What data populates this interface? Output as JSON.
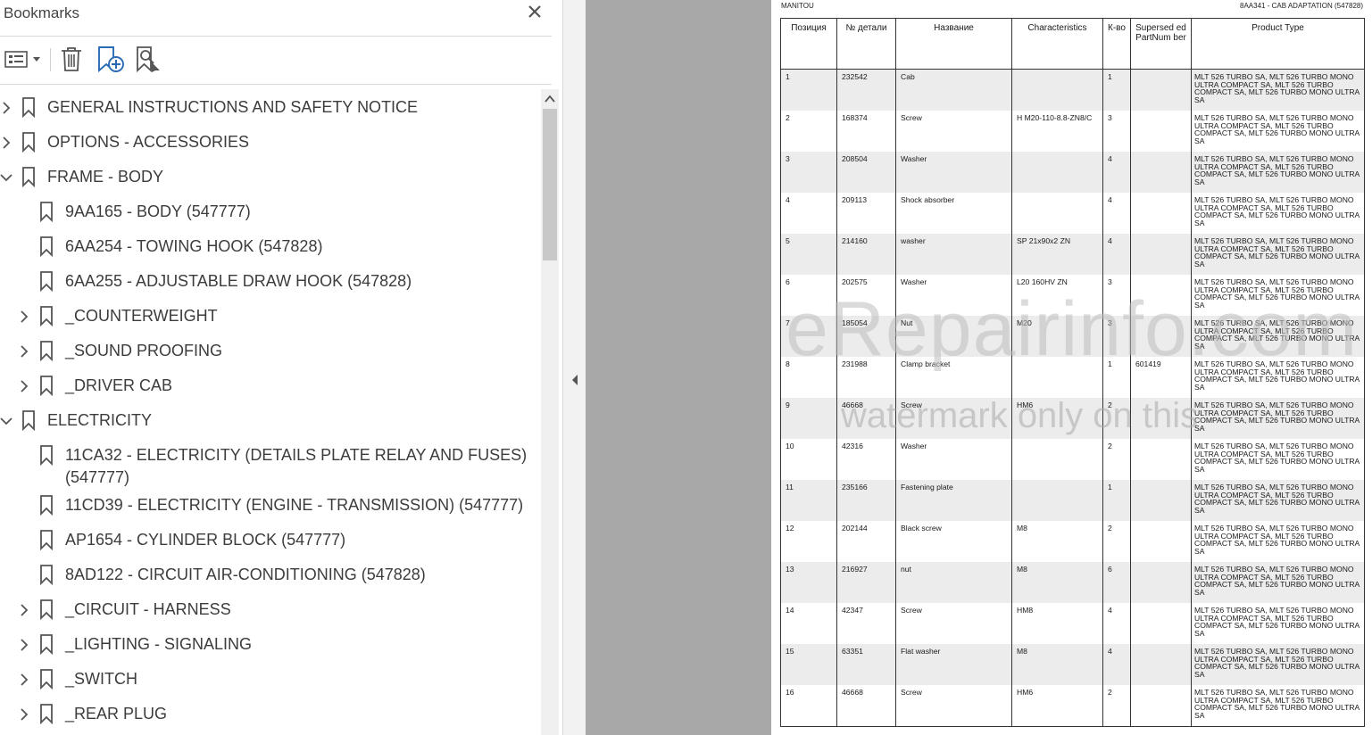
{
  "panel": {
    "title": "Bookmarks",
    "items": [
      {
        "label": "GENERAL INSTRUCTIONS AND SAFETY NOTICE",
        "expander": "collapsed",
        "indent": 0
      },
      {
        "label": "OPTIONS - ACCESSORIES",
        "expander": "collapsed",
        "indent": 0
      },
      {
        "label": "FRAME - BODY",
        "expander": "expanded",
        "indent": 0
      },
      {
        "label": "9AA165 - BODY (547777)",
        "expander": "none",
        "indent": 1
      },
      {
        "label": "6AA254 - TOWING HOOK (547828)",
        "expander": "none",
        "indent": 1
      },
      {
        "label": "6AA255 - ADJUSTABLE DRAW HOOK (547828)",
        "expander": "none",
        "indent": 1
      },
      {
        "label": "_COUNTERWEIGHT",
        "expander": "collapsed",
        "indent": 1
      },
      {
        "label": "_SOUND PROOFING",
        "expander": "collapsed",
        "indent": 1
      },
      {
        "label": "_DRIVER CAB",
        "expander": "collapsed",
        "indent": 1
      },
      {
        "label": "ELECTRICITY",
        "expander": "expanded",
        "indent": 0
      },
      {
        "label": "11CA32 - ELECTRICITY (DETAILS PLATE RELAY AND FUSES)",
        "label2": "(547777)",
        "expander": "none",
        "indent": 1
      },
      {
        "label": "11CD39 - ELECTRICITY (ENGINE - TRANSMISSION) (547777)",
        "expander": "none",
        "indent": 1
      },
      {
        "label": "AP1654 - CYLINDER BLOCK (547777)",
        "expander": "none",
        "indent": 1
      },
      {
        "label": "8AD122 - CIRCUIT AIR-CONDITIONING (547828)",
        "expander": "none",
        "indent": 1
      },
      {
        "label": "_CIRCUIT - HARNESS",
        "expander": "collapsed",
        "indent": 1
      },
      {
        "label": "_LIGHTING  - SIGNALING",
        "expander": "collapsed",
        "indent": 1
      },
      {
        "label": "_SWITCH",
        "expander": "collapsed",
        "indent": 1
      },
      {
        "label": "_REAR PLUG",
        "expander": "collapsed",
        "indent": 1
      }
    ]
  },
  "document": {
    "header_left": "MANITOU",
    "header_right": "8AA341 - CAB ADAPTATION (547828)",
    "columns": [
      "Позиция",
      "№ детали",
      "Название",
      "Characteristics",
      "К-во",
      "Supersed ed PartNum ber",
      "Product Type"
    ],
    "product_type": "MLT 526 TURBO SA, MLT 526 TURBO MONO ULTRA COMPACT SA, MLT 526 TURBO COMPACT SA, MLT 526 TURBO MONO ULTRA SA",
    "rows": [
      {
        "pos": "1",
        "part": "232542",
        "name": "Cab",
        "char": "",
        "qty": "1",
        "sup": ""
      },
      {
        "pos": "2",
        "part": "168374",
        "name": "Screw",
        "char": "H M20-110-8.8-ZN8/C",
        "qty": "3",
        "sup": ""
      },
      {
        "pos": "3",
        "part": "208504",
        "name": "Washer",
        "char": "",
        "qty": "4",
        "sup": ""
      },
      {
        "pos": "4",
        "part": "209113",
        "name": "Shock absorber",
        "char": "",
        "qty": "4",
        "sup": ""
      },
      {
        "pos": "5",
        "part": "214160",
        "name": "washer",
        "char": "SP 21x90x2 ZN",
        "qty": "4",
        "sup": ""
      },
      {
        "pos": "6",
        "part": "202575",
        "name": "Washer",
        "char": "L20 160HV ZN",
        "qty": "3",
        "sup": ""
      },
      {
        "pos": "7",
        "part": "185054",
        "name": "Nut",
        "char": "M20",
        "qty": "3",
        "sup": ""
      },
      {
        "pos": "8",
        "part": "231988",
        "name": "Clamp bracket",
        "char": "",
        "qty": "1",
        "sup": "601419"
      },
      {
        "pos": "9",
        "part": "46668",
        "name": "Screw",
        "char": "HM6",
        "qty": "2",
        "sup": ""
      },
      {
        "pos": "10",
        "part": "42316",
        "name": "Washer",
        "char": "",
        "qty": "2",
        "sup": ""
      },
      {
        "pos": "11",
        "part": "235166",
        "name": "Fastening plate",
        "char": "",
        "qty": "1",
        "sup": ""
      },
      {
        "pos": "12",
        "part": "202144",
        "name": "Black screw",
        "char": "M8",
        "qty": "2",
        "sup": ""
      },
      {
        "pos": "13",
        "part": "216927",
        "name": "nut",
        "char": "M8",
        "qty": "6",
        "sup": ""
      },
      {
        "pos": "14",
        "part": "42347",
        "name": "Screw",
        "char": "HM8",
        "qty": "4",
        "sup": ""
      },
      {
        "pos": "15",
        "part": "63351",
        "name": "Flat washer",
        "char": "M8",
        "qty": "4",
        "sup": ""
      },
      {
        "pos": "16",
        "part": "46668",
        "name": "Screw",
        "char": "HM6",
        "qty": "2",
        "sup": ""
      }
    ]
  },
  "watermark": {
    "line1": "eRepairinfo.com",
    "line2": "watermark only on this"
  }
}
